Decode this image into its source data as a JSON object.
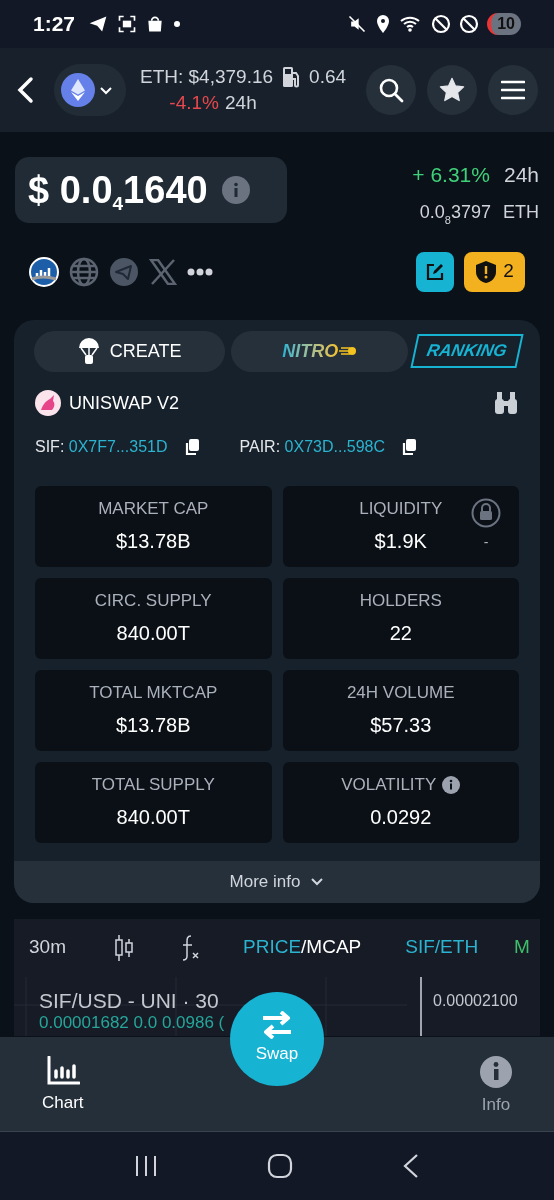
{
  "status_bar": {
    "time": "1:27",
    "battery": "10"
  },
  "header": {
    "eth_price": "ETH: $4,379.16",
    "gas": "0.64",
    "change": "-4.1%",
    "period": "24h"
  },
  "token": {
    "price_lead": "$ 0.0",
    "price_zeros": "4",
    "price_digits": "1640",
    "change": "+ 6.31%",
    "period": "24h",
    "eth_lead": "0.0",
    "eth_zeros": "8",
    "eth_digits": "3797",
    "eth_unit": "ETH"
  },
  "warning_count": "2",
  "tabs": [
    {
      "label": "CREATE",
      "kind": "create"
    },
    {
      "label": "NITRO",
      "kind": "nitro"
    },
    {
      "label": "RANKING",
      "kind": "ranking"
    }
  ],
  "dex": "UNISWAP V2",
  "addresses": [
    {
      "label": "SIF:",
      "value": "0X7F7...351D"
    },
    {
      "label": "PAIR:",
      "value": "0X73D...598C"
    }
  ],
  "stats": [
    {
      "label": "MARKET CAP",
      "value": "$13.78B",
      "kind": "plain"
    },
    {
      "label": "LIQUIDITY",
      "value": "$1.9K",
      "kind": "locked",
      "note": "-"
    },
    {
      "label": "CIRC. SUPPLY",
      "value": "840.00T",
      "kind": "plain"
    },
    {
      "label": "HOLDERS",
      "value": "22",
      "kind": "plain"
    },
    {
      "label": "TOTAL MKTCAP",
      "value": "$13.78B",
      "kind": "plain"
    },
    {
      "label": "24H VOLUME",
      "value": "$57.33",
      "kind": "plain"
    },
    {
      "label": "TOTAL SUPPLY",
      "value": "840.00T",
      "kind": "plain"
    },
    {
      "label": "VOLATILITY",
      "value": "0.0292",
      "kind": "info"
    }
  ],
  "more_info": "More info",
  "chart_toolbar": {
    "interval": "30m",
    "modes": [
      {
        "label": "PRICE",
        "selected": true
      },
      {
        "label": "MCAP",
        "selected": false
      }
    ],
    "separator": "/",
    "pair": "SIF/ETH",
    "cut": "M"
  },
  "chart": {
    "title": "SIF/USD - UNI · 30",
    "ohlc": "0.00001682  0.0 0.0986 (",
    "price_label": "0.00002100"
  },
  "bottom_nav": [
    {
      "label": "Chart",
      "kind": "chart",
      "selected": true
    },
    {
      "label": "Swap",
      "kind": "swap"
    },
    {
      "label": "Info",
      "kind": "info",
      "selected": false
    }
  ]
}
